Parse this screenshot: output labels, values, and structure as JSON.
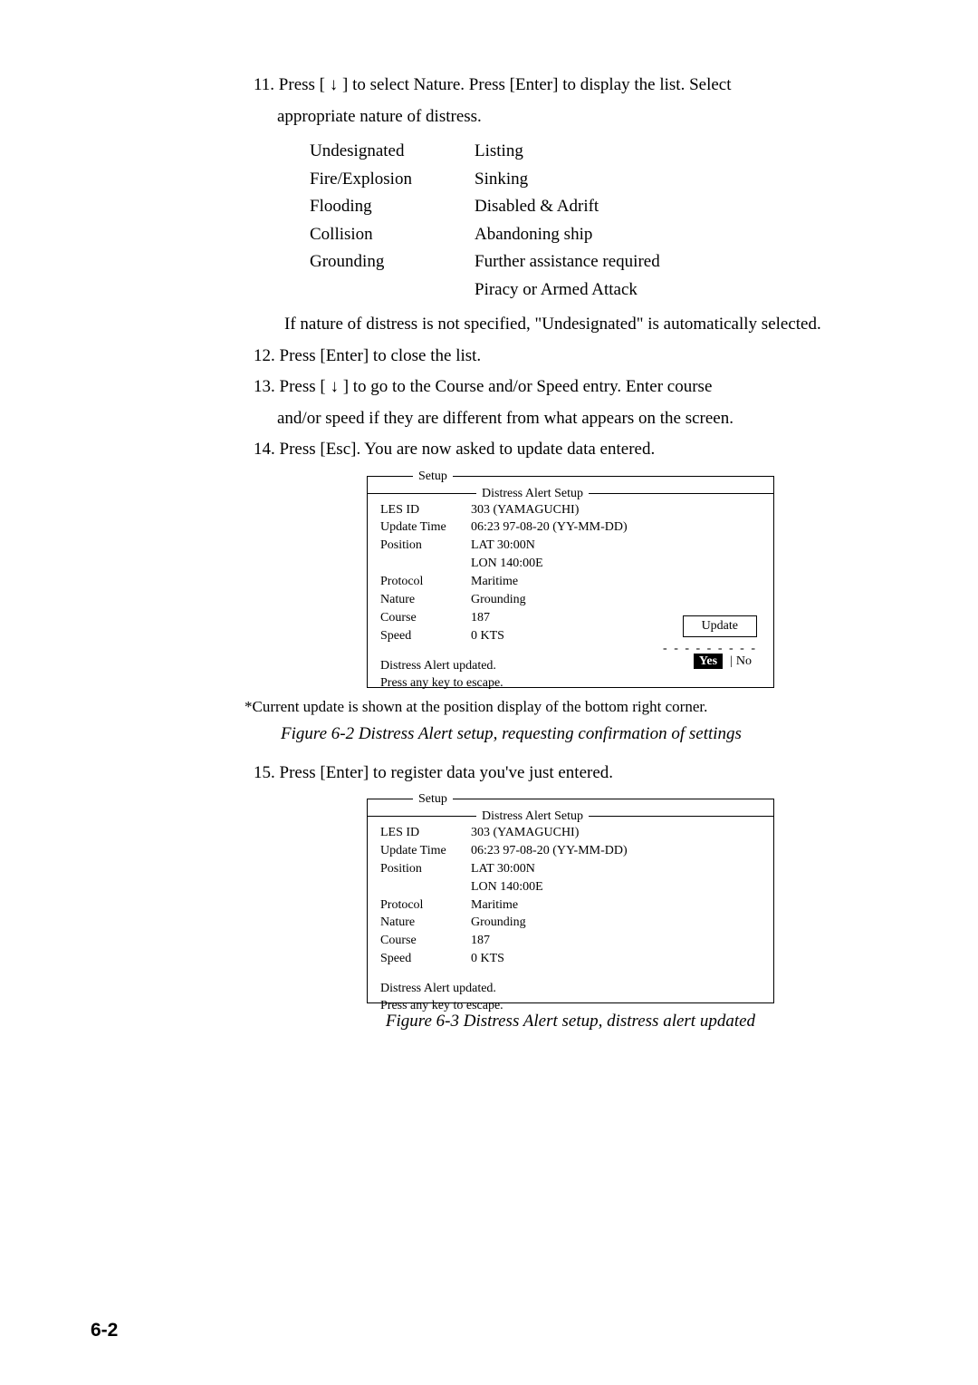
{
  "steps": {
    "s11a": "11. Press [ ",
    "s11b": " ] to select Nature. Press [Enter] to display the list. Select",
    "s11c": "appropriate nature of distress.",
    "s11_note": "If nature of distress is not specified, \"Undesignated\" is automatically selected.",
    "s12": "12. Press [Enter] to close the list.",
    "s13a": "13. Press [ ",
    "s13b": " ] to go to the Course and/or Speed entry. Enter course",
    "s13c": "and/or speed if they are different from what appears on the screen.",
    "s14": "14. Press [Esc]. You are now asked to update data entered.",
    "s15": "15. Press [Enter] to register data you've just entered."
  },
  "arrow": "↓",
  "distress_list": {
    "left": [
      "Undesignated",
      "Fire/Explosion",
      "Flooding",
      "Collision",
      "Grounding",
      ""
    ],
    "right": [
      "Listing",
      "Sinking",
      "Disabled & Adrift",
      "Abandoning ship",
      "Further assistance required",
      "Piracy or Armed Attack"
    ]
  },
  "setup1": {
    "outer_title": "Setup",
    "inner_title": "Distress Alert Setup",
    "les_id_k": "LES ID",
    "les_id_v": "303 (YAMAGUCHI)",
    "update_time_k": "Update Time",
    "update_time_v": "06:23  97-08-20 (YY-MM-DD)",
    "position_k": "Position",
    "lat_v": "LAT    30:00N",
    "lon_v": "LON  140:00E",
    "protocol_k": "Protocol",
    "protocol_v": "Maritime",
    "nature_k": "Nature",
    "nature_v": "Grounding",
    "course_k": "Course",
    "course_v": "187",
    "speed_k": "Speed",
    "speed_v": "0   KTS",
    "update_btn": "Update",
    "dash": "- - - - - - - - -",
    "yes": "Yes",
    "no": "No",
    "msg1": "Distress Alert updated.",
    "msg2": "Press any key to escape."
  },
  "note1": "*Current update is shown at the position display of the bottom right corner.",
  "caption1": "Figure 6-2  Distress Alert setup, requesting confirmation of settings",
  "caption2": "Figure 6-3 Distress Alert setup, distress alert updated",
  "page_number": "6-2"
}
